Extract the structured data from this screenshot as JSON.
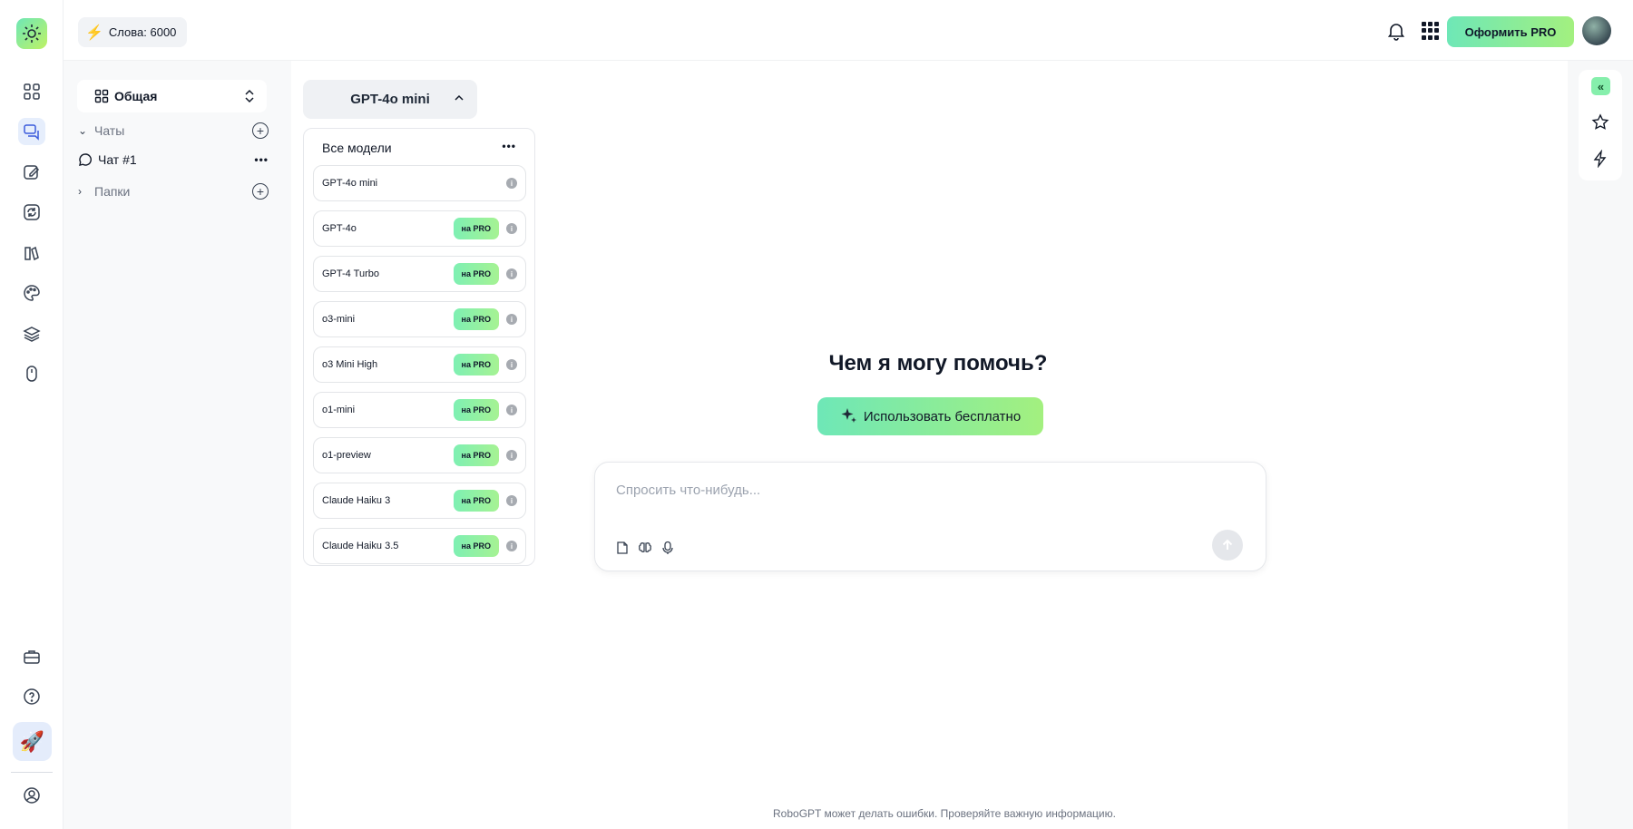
{
  "topbar": {
    "words_label": "Слова: 6000",
    "pro_button": "Оформить PRO",
    "icons": [
      "bell-icon",
      "apps-grid-icon"
    ]
  },
  "rail": {
    "icons": [
      "logo-icon",
      "dashboard-icon",
      "chat-icon",
      "edit-icon",
      "refresh-icon",
      "books-icon",
      "palette-icon",
      "layers-icon",
      "mouse-icon",
      "briefcase-icon",
      "help-icon",
      "rocket-icon",
      "profile-icon"
    ]
  },
  "sidebar": {
    "workspace": "Общая",
    "chats_label": "Чаты",
    "chat_items": [
      "Чат #1"
    ],
    "folders_label": "Папки",
    "dots": "•••"
  },
  "model_selector": {
    "current": "GPT-4o mini",
    "header": "Все модели",
    "dots": "•••",
    "pro_tag": "на PRO",
    "models": [
      {
        "name": "GPT-4o mini",
        "pro": false
      },
      {
        "name": "GPT-4o",
        "pro": true
      },
      {
        "name": "GPT-4 Turbo",
        "pro": true
      },
      {
        "name": "o3-mini",
        "pro": true
      },
      {
        "name": "o3 Mini High",
        "pro": true
      },
      {
        "name": "o1-mini",
        "pro": true
      },
      {
        "name": "o1-preview",
        "pro": true
      },
      {
        "name": "Claude Haiku 3",
        "pro": true
      },
      {
        "name": "Claude Haiku 3.5",
        "pro": true
      }
    ]
  },
  "main": {
    "headline": "Чем я могу помочь?",
    "free_button": "Использовать бесплатно",
    "input_placeholder": "Спросить что-нибудь...",
    "disclaimer": "RoboGPT может делать ошибки. Проверяйте важную информацию."
  },
  "colors": {
    "accent_gradient_start": "#6ee7b7",
    "accent_gradient_end": "#a3f07f",
    "active_rail_bg": "#e6eefc"
  }
}
